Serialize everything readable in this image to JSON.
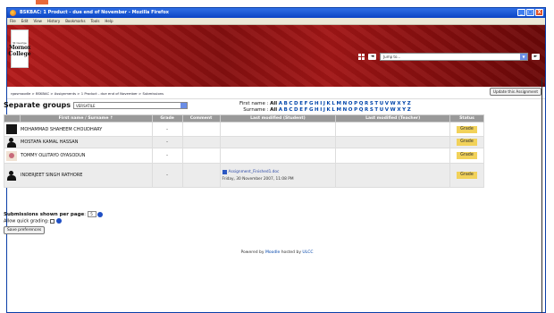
{
  "window": {
    "title": "BSKBAC: 1 Product - due end of November - Mozilla Firefox",
    "buttons": [
      "_",
      "□",
      "X"
    ]
  },
  "menu": [
    "File",
    "Edit",
    "View",
    "History",
    "Bookmarks",
    "Tools",
    "Help"
  ],
  "logo": {
    "line1": "St George",
    "line2": "Mornox",
    "line3": "College"
  },
  "banner": {
    "jump_placeholder": "Jump to..."
  },
  "breadcrumb": "rgosmoodle > BSKBAC > Assignments > 1 Product - due end of November > Submissions",
  "update_button": "Update this Assignment",
  "groups": {
    "label": "Separate groups",
    "selected": "VERSATILE"
  },
  "filters": {
    "first_name_label": "First name : ",
    "surname_label": "Surname : ",
    "all": "All",
    "letters": [
      "A",
      "B",
      "C",
      "D",
      "E",
      "F",
      "G",
      "H",
      "I",
      "J",
      "K",
      "L",
      "M",
      "N",
      "O",
      "P",
      "Q",
      "R",
      "S",
      "T",
      "U",
      "V",
      "W",
      "X",
      "Y",
      "Z"
    ]
  },
  "table": {
    "headers": [
      "",
      "First name / Surname",
      "Grade",
      "Comment",
      "Last modified (Student)",
      "Last modified (Teacher)",
      "Status"
    ],
    "sort_marker": "↑",
    "rows": [
      {
        "name": "MOHAMMAD SHAHEEM CHOUDHARY",
        "grade": "-",
        "status": "Grade",
        "file": "",
        "date": ""
      },
      {
        "name": "MOSTAFA KAMAL HASSAN",
        "grade": "-",
        "status": "Grade",
        "file": "",
        "date": ""
      },
      {
        "name": "TOMMY OLUTAYO OYASODUN",
        "grade": "-",
        "status": "Grade",
        "file": "",
        "date": ""
      },
      {
        "name": "INDERJEET SINGH RATHORE",
        "grade": "-",
        "status": "Grade",
        "file": "Assignment_Finished1.doc",
        "date": "Friday, 30 November 2007, 11:08 PM"
      }
    ]
  },
  "prefs": {
    "per_page_label": "Submissions shown per page",
    "per_page_value": "5",
    "quick_grading_label": "Allow quick grading: ",
    "save_label": "Save preferences"
  },
  "footer": {
    "prefix": "Powered by ",
    "moodle": "Moodle",
    "middle": " hosted by ",
    "host": "ULCC"
  },
  "colors": {
    "banner": "#a21616",
    "titlebar": "#0b44c4",
    "grade_button": "#f2d25a",
    "table_header": "#999999"
  }
}
